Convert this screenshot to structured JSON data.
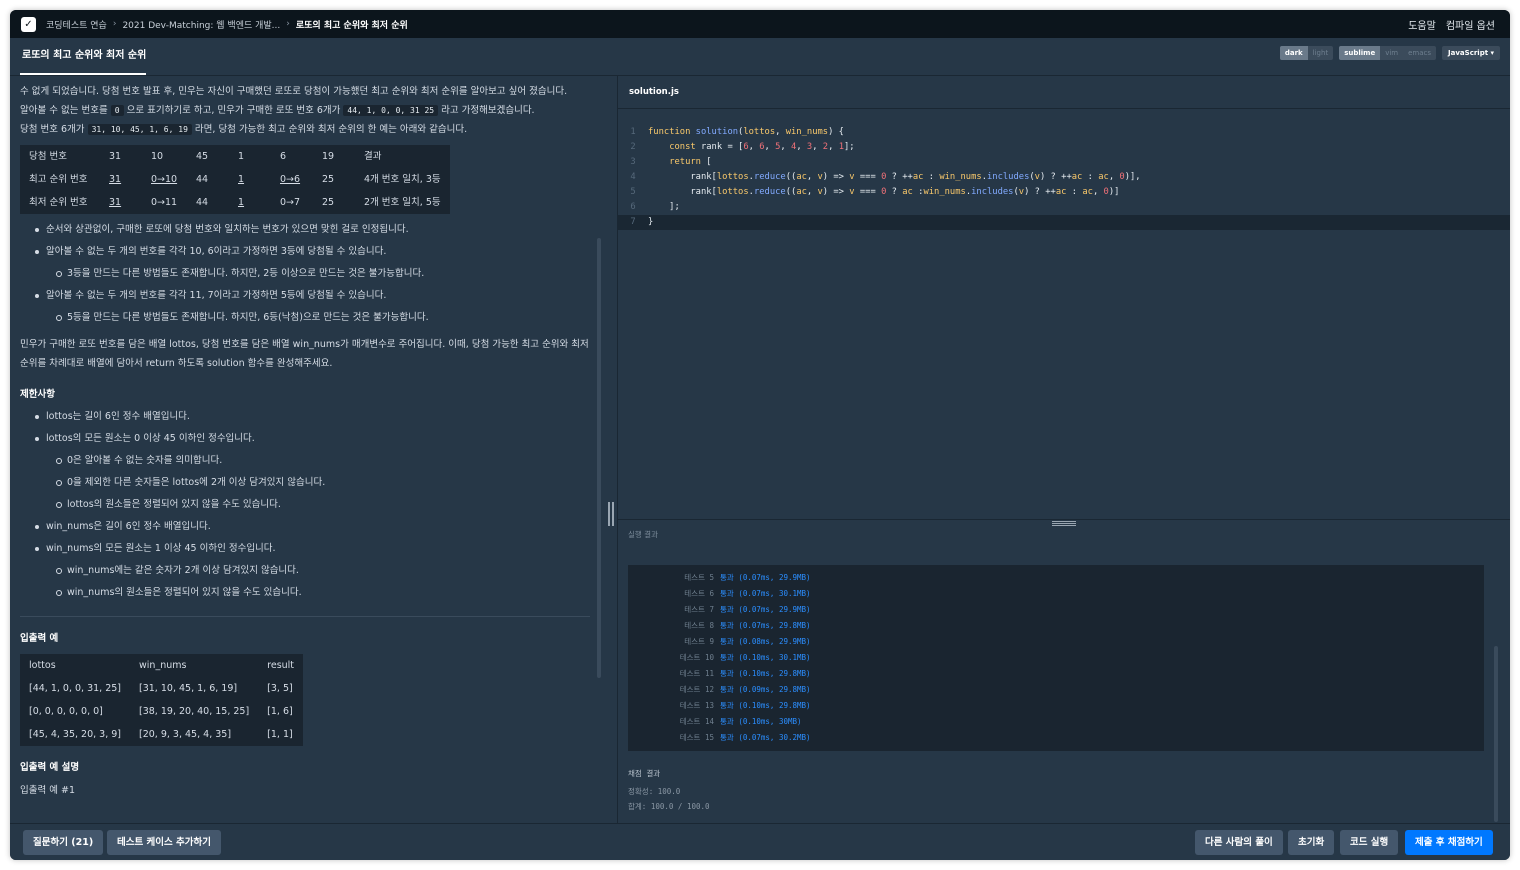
{
  "nav": {
    "crumbs": [
      "코딩테스트 연습",
      "2021 Dev-Matching: 웹 백엔드 개발...",
      "로또의 최고 순위와 최저 순위"
    ],
    "help": "도움말",
    "compile_options": "컴파일 옵션"
  },
  "tab": {
    "title": "로또의 최고 순위와 최저 순위"
  },
  "editor_options": {
    "themes": [
      "dark",
      "light"
    ],
    "keymaps": [
      "sublime",
      "vim",
      "emacs"
    ],
    "language": "JavaScript"
  },
  "problem": {
    "p1": "수 없게 되었습니다. 당첨 번호 발표 후, 민우는 자신이 구매했던 로또로 당첨이 가능했던 최고 순위와 최저 순위를 알아보고 싶어 졌습니다.",
    "p2_a": "알아볼 수 없는 번호를",
    "p2_code1": "0",
    "p2_b": "으로 표기하기로 하고, 민우가 구매한 로또 번호 6개가",
    "p2_code2": "44, 1, 0, 0, 31 25",
    "p2_c": "라고 가정해보겠습니다.",
    "p3_a": "당첨 번호 6개가",
    "p3_code": "31, 10, 45, 1, 6, 19",
    "p3_b": "라면, 당첨 가능한 최고 순위와 최저 순위의 한 예는 아래와 같습니다.",
    "rank_table": [
      [
        "당첨 번호",
        "31",
        "10",
        "45",
        "1",
        "6",
        "19",
        "결과"
      ],
      [
        "최고 순위 번호",
        "31",
        "0→10",
        "44",
        "1",
        "0→6",
        "25",
        "4개 번호 일치, 3등"
      ],
      [
        "최저 순위 번호",
        "31",
        "0→11",
        "44",
        "1",
        "0→7",
        "25",
        "2개 번호 일치, 5등"
      ]
    ],
    "bullets": [
      {
        "level": 1,
        "text": "순서와 상관없이, 구매한 로또에 당첨 번호와 일치하는 번호가 있으면 맞힌 걸로 인정됩니다."
      },
      {
        "level": 1,
        "text": "알아볼 수 없는 두 개의 번호를 각각 10, 6이라고 가정하면 3등에 당첨될 수 있습니다."
      },
      {
        "level": 2,
        "text": "3등을 만드는 다른 방법들도 존재합니다. 하지만, 2등 이상으로 만드는 것은 불가능합니다."
      },
      {
        "level": 1,
        "text": "알아볼 수 없는 두 개의 번호를 각각 11, 7이라고 가정하면 5등에 당첨될 수 있습니다."
      },
      {
        "level": 2,
        "text": "5등을 만드는 다른 방법들도 존재합니다. 하지만, 6등(낙첨)으로 만드는 것은 불가능합니다."
      }
    ],
    "p4": "민우가 구매한 로또 번호를 담은 배열 lottos, 당첨 번호를 담은 배열 win_nums가 매개변수로 주어집니다. 이때, 당첨 가능한 최고 순위와 최저 순위를 차례대로 배열에 담아서 return 하도록 solution 함수를 완성해주세요.",
    "constraints_title": "제한사항",
    "constraints": [
      {
        "level": 1,
        "text": "lottos는 길이 6인 정수 배열입니다."
      },
      {
        "level": 1,
        "text": "lottos의 모든 원소는 0 이상 45 이하인 정수입니다."
      },
      {
        "level": 2,
        "text": "0은 알아볼 수 없는 숫자를 의미합니다."
      },
      {
        "level": 2,
        "text": "0을 제외한 다른 숫자들은 lottos에 2개 이상 담겨있지 않습니다."
      },
      {
        "level": 2,
        "text": "lottos의 원소들은 정렬되어 있지 않을 수도 있습니다."
      },
      {
        "level": 1,
        "text": "win_nums은 길이 6인 정수 배열입니다."
      },
      {
        "level": 1,
        "text": "win_nums의 모든 원소는 1 이상 45 이하인 정수입니다."
      },
      {
        "level": 2,
        "text": "win_nums에는 같은 숫자가 2개 이상 담겨있지 않습니다."
      },
      {
        "level": 2,
        "text": "win_nums의 원소들은 정렬되어 있지 않을 수도 있습니다."
      }
    ],
    "io_title": "입출력 예",
    "io_table": [
      [
        "lottos",
        "win_nums",
        "result"
      ],
      [
        "[44, 1, 0, 0, 31, 25]",
        "[31, 10, 45, 1, 6, 19]",
        "[3, 5]"
      ],
      [
        "[0, 0, 0, 0, 0, 0]",
        "[38, 19, 20, 40, 15, 25]",
        "[1, 6]"
      ],
      [
        "[45, 4, 35, 20, 3, 9]",
        "[20, 9, 3, 45, 4, 35]",
        "[1, 1]"
      ]
    ],
    "io_explain_title": "입출력 예 설명",
    "io_example1": "입출력 예 #1"
  },
  "editor": {
    "filename": "solution.js",
    "lines": [
      "function solution(lottos, win_nums) {",
      "    const rank = [6, 6, 5, 4, 3, 2, 1];",
      "    return [",
      "        rank[lottos.reduce((ac, v) => v === 0 ? ++ac : win_nums.includes(v) ? ++ac : ac, 0)],",
      "        rank[lottos.reduce((ac, v) => v === 0 ? ac :win_nums.includes(v) ? ++ac : ac, 0)]",
      "    ];",
      "}"
    ]
  },
  "results": {
    "label": "실행 결과",
    "tests": [
      {
        "name": "테스트 5",
        "status": "통과",
        "detail": "(0.07ms, 29.9MB)"
      },
      {
        "name": "테스트 6",
        "status": "통과",
        "detail": "(0.07ms, 30.1MB)"
      },
      {
        "name": "테스트 7",
        "status": "통과",
        "detail": "(0.07ms, 29.9MB)"
      },
      {
        "name": "테스트 8",
        "status": "통과",
        "detail": "(0.07ms, 29.8MB)"
      },
      {
        "name": "테스트 9",
        "status": "통과",
        "detail": "(0.08ms, 29.9MB)"
      },
      {
        "name": "테스트 10",
        "status": "통과",
        "detail": "(0.10ms, 30.1MB)"
      },
      {
        "name": "테스트 11",
        "status": "통과",
        "detail": "(0.10ms, 29.8MB)"
      },
      {
        "name": "테스트 12",
        "status": "통과",
        "detail": "(0.09ms, 29.8MB)"
      },
      {
        "name": "테스트 13",
        "status": "통과",
        "detail": "(0.10ms, 29.8MB)"
      },
      {
        "name": "테스트 14",
        "status": "통과",
        "detail": "(0.10ms, 30MB)"
      },
      {
        "name": "테스트 15",
        "status": "통과",
        "detail": "(0.07ms, 30.2MB)"
      }
    ],
    "grade_title": "채점 결과",
    "accuracy": "정확성: 100.0",
    "total": "합계: 100.0 / 100.0"
  },
  "footer": {
    "ask": "질문하기 (21)",
    "add_test": "테스트 케이스 추가하기",
    "others": "다른 사람의 풀이",
    "reset": "초기화",
    "run": "코드 실행",
    "submit": "제출 후 채점하기"
  },
  "colors": {
    "background": "#263747",
    "nav": "#0c151c",
    "primary_button": "#0078ff",
    "pass": "#2b8eff"
  }
}
